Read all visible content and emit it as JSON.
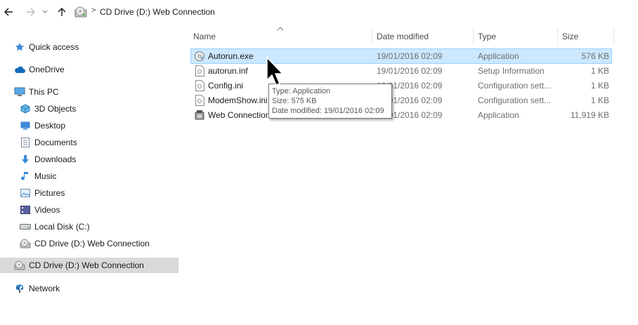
{
  "address_bar": {
    "back_icon": "arrow-left-icon",
    "forward_icon": "arrow-right-icon",
    "recent_icon": "chevron-down-icon",
    "up_icon": "arrow-up-icon",
    "location_icon": "cd-drive-icon",
    "separator": ">",
    "path": "CD Drive (D:) Web Connection"
  },
  "sidebar": {
    "items": [
      {
        "label": "Quick access",
        "icon": "star-icon"
      },
      {
        "label": "OneDrive",
        "icon": "cloud-icon"
      },
      {
        "label": "This PC",
        "icon": "computer-icon"
      },
      {
        "label": "3D Objects",
        "icon": "cube-icon"
      },
      {
        "label": "Desktop",
        "icon": "desktop-icon"
      },
      {
        "label": "Documents",
        "icon": "documents-icon"
      },
      {
        "label": "Downloads",
        "icon": "download-icon"
      },
      {
        "label": "Music",
        "icon": "music-icon"
      },
      {
        "label": "Pictures",
        "icon": "pictures-icon"
      },
      {
        "label": "Videos",
        "icon": "videos-icon"
      },
      {
        "label": "Local Disk (C:)",
        "icon": "hard-disk-icon"
      },
      {
        "label": "CD Drive (D:) Web Connection",
        "icon": "cd-drive-icon"
      },
      {
        "label": "CD Drive (D:) Web Connection",
        "icon": "cd-drive-icon"
      },
      {
        "label": "Network",
        "icon": "network-icon"
      }
    ]
  },
  "columns": {
    "name": "Name",
    "date_modified": "Date modified",
    "type": "Type",
    "size": "Size"
  },
  "files": [
    {
      "name": "Autorun.exe",
      "date": "19/01/2016 02:09",
      "type": "Application",
      "size": "576 KB",
      "icon": "cd-autorun-icon"
    },
    {
      "name": "autorun.inf",
      "date": "19/01/2016 02:09",
      "type": "Setup Information",
      "size": "1 KB",
      "icon": "settings-file-icon"
    },
    {
      "name": "Config.ini",
      "date": "19/01/2016 02:09",
      "type": "Configuration sett...",
      "size": "1 KB",
      "icon": "settings-file-icon"
    },
    {
      "name": "ModemShow.ini",
      "date": "19/01/2016 02:09",
      "type": "Configuration sett...",
      "size": "1 KB",
      "icon": "settings-file-icon"
    },
    {
      "name": "Web Connection",
      "date": "19/01/2016 02:09",
      "type": "Application",
      "size": "11,919 KB",
      "icon": "application-icon"
    }
  ],
  "tooltip": {
    "type_line": "Type: Application",
    "size_line": "Size: 575 KB",
    "date_line": "Date modified: 19/01/2016 02:09"
  },
  "colors": {
    "selection_bg": "#cce8ff",
    "selection_border": "#99d1ff",
    "sidebar_selected": "#d9d9d9",
    "accent_blue": "#3b8ad9"
  }
}
